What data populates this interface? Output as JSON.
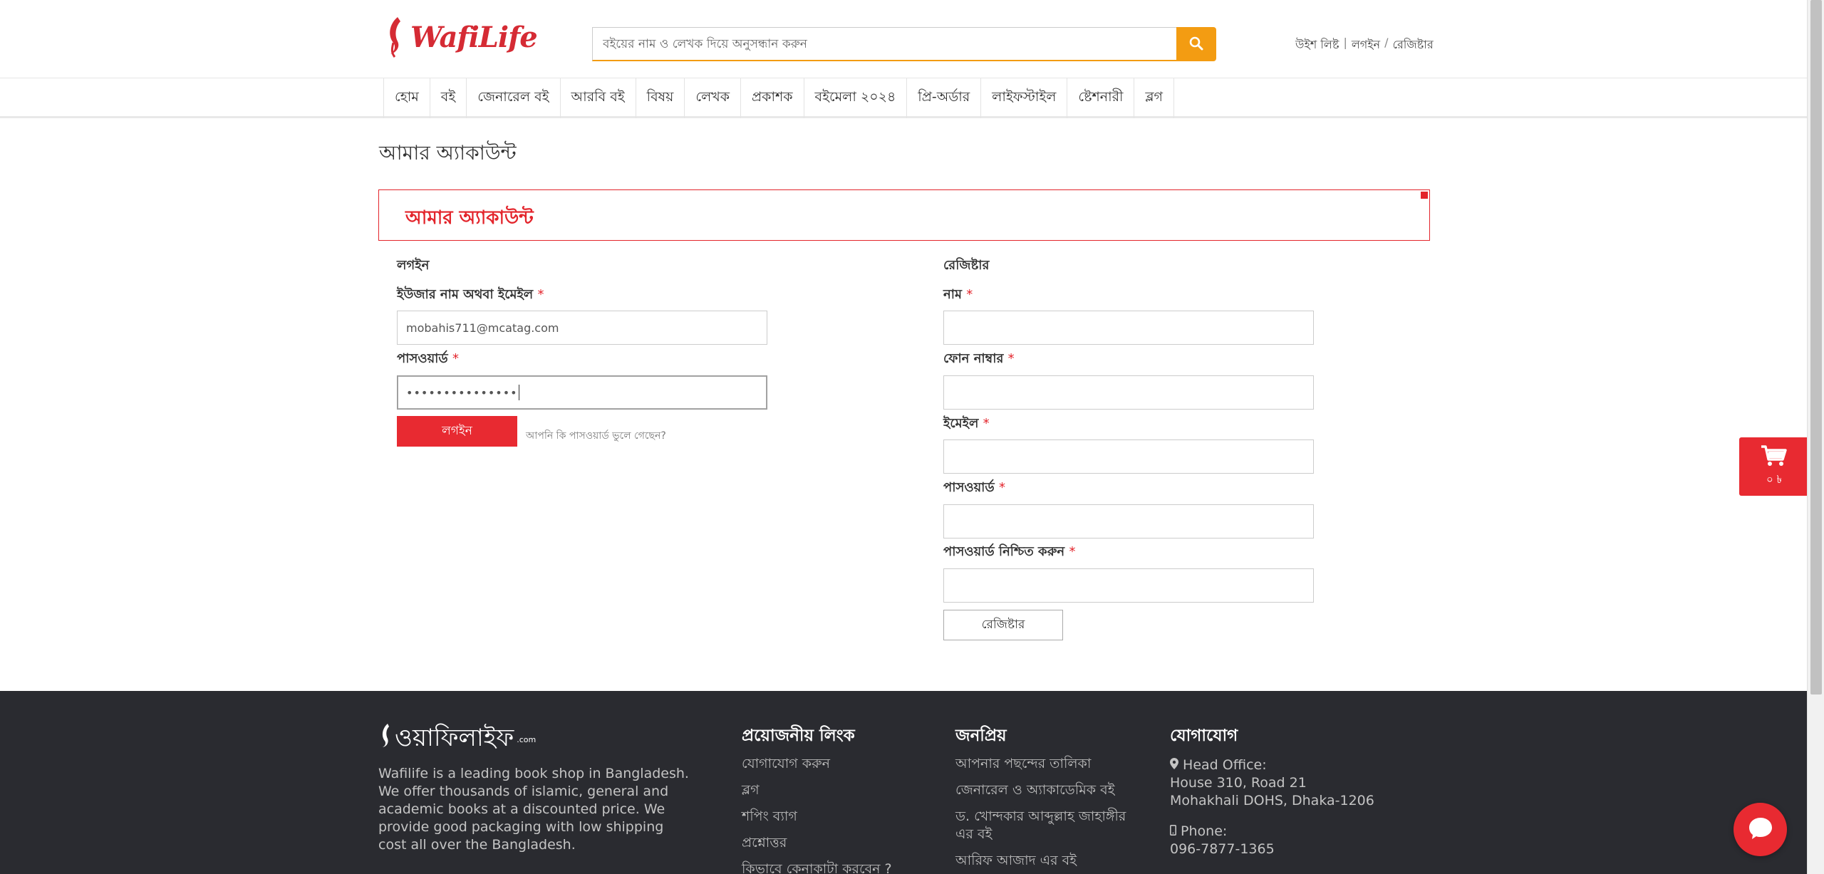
{
  "header": {
    "logo_text": "WafiLife",
    "search_placeholder": "বইয়ের নাম ও লেখক দিয়ে অনুসন্ধান করুন",
    "top_links": {
      "wishlist": "উইশ লিষ্ট",
      "sep": "|",
      "login": "লগইন",
      "slash": "/",
      "register": "রেজিষ্টার"
    }
  },
  "nav": {
    "items": [
      "হোম",
      "বই",
      "জেনারেল বই",
      "আরবি বই",
      "বিষয়",
      "লেখক",
      "প্রকাশক",
      "বইমেলা ২০২৪",
      "প্রি-অর্ডার",
      "লাইফস্টাইল",
      "ষ্টেশনারী",
      "ব্লগ"
    ]
  },
  "page": {
    "title": "আমার অ্যাকাউন্ট",
    "box_heading": "আমার অ্যাকাউন্ট"
  },
  "login": {
    "title": "লগইন",
    "username_label": "ইউজার নাম অথবা ইমেইল",
    "username_value": "mobahis711@mcatag.com",
    "password_label": "পাসওয়ার্ড",
    "password_value": "•••••••••••••••",
    "required": "*",
    "button": "লগইন",
    "forgot": "আপনি কি পাসওয়ার্ড ভুলে গেছেন?"
  },
  "register": {
    "title": "রেজিষ্টার",
    "name_label": "নাম",
    "phone_label": "ফোন নাম্বার",
    "email_label": "ইমেইল",
    "password_label": "পাসওয়ার্ড",
    "confirm_label": "পাসওয়ার্ড নিশ্চিত করুন",
    "required": "*",
    "button": "রেজিষ্টার"
  },
  "cart": {
    "count": "০ ৳"
  },
  "footer": {
    "logo_text": "ওয়াফিলাইফ",
    "logo_tm": ".com",
    "about": "Wafilife is a leading book shop in Bangladesh. We offer thousands of islamic, general and academic books at a discounted price. We provide good packaging with low shipping cost all over the Bangladesh.",
    "links_title": "প্রয়োজনীয় লিংক",
    "links": [
      "যোগাযোগ করুন",
      "ব্লগ",
      "শপিং ব্যাগ",
      "প্রশ্নোত্তর",
      "কিভাবে কেনাকাটা করবেন ?"
    ],
    "popular_title": "জনপ্রিয়",
    "popular": [
      "আপনার পছন্দের তালিকা",
      "জেনারেল ও অ্যাকাডেমিক বই",
      "ড. খোন্দকার আব্দুল্লাহ জাহাঙ্গীর এর বই",
      "আরিফ আজাদ এর বই"
    ],
    "contact_title": "যোগাযোগ",
    "head_office_label": "Head Office:",
    "address_line1": "House 310, Road 21",
    "address_line2": "Mohakhali DOHS, Dhaka-1206",
    "phone_label": "Phone:",
    "phone": "096-7877-1365"
  },
  "colors": {
    "brand_red": "#e3242b",
    "search_orange": "#f39c12",
    "footer_bg": "#2a2b30"
  }
}
